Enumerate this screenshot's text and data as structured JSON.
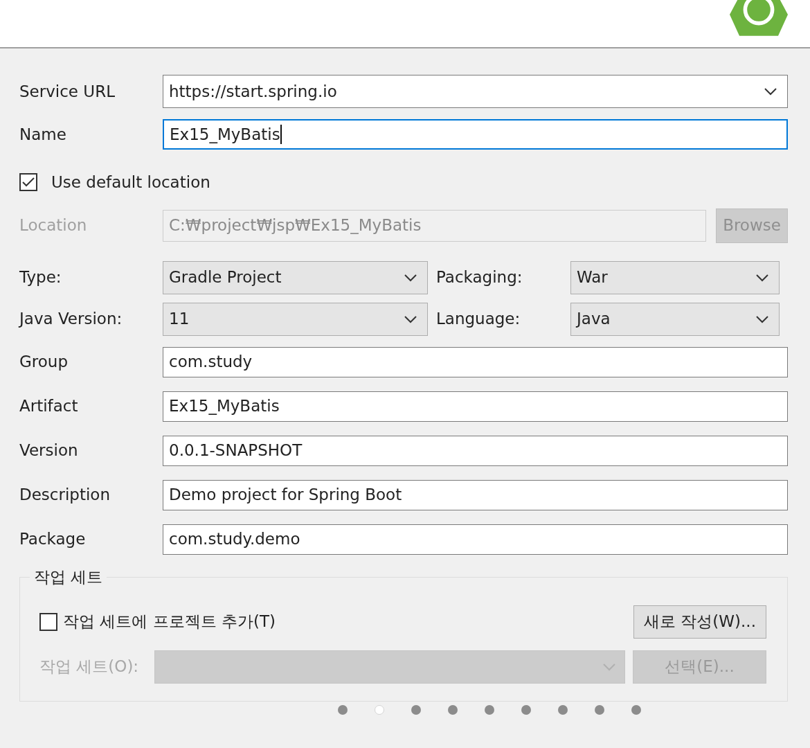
{
  "fields": [
    {
      "label": "Service URL",
      "kind": "combo",
      "value": "https://start.spring.io",
      "focused": false
    },
    {
      "label": "Name",
      "kind": "text",
      "value": "Ex15_MyBatis",
      "focused": true
    }
  ],
  "use_default_location": {
    "label": "Use default location",
    "checked": true
  },
  "location": {
    "label": "Location",
    "value": "C:₩project₩jsp₩Ex15_MyBatis",
    "disabled": true,
    "button": "Browse"
  },
  "options": [
    {
      "label": "Type:",
      "value": "Gradle Project"
    },
    {
      "label": "Packaging:",
      "value": "War"
    },
    {
      "label": "Java Version:",
      "value": "11"
    },
    {
      "label": "Language:",
      "value": "Java"
    }
  ],
  "details": [
    {
      "label": "Group",
      "value": "com.study"
    },
    {
      "label": "Artifact",
      "value": "Ex15_MyBatis"
    },
    {
      "label": "Version",
      "value": "0.0.1-SNAPSHOT"
    },
    {
      "label": "Description",
      "value": "Demo project for Spring Boot"
    },
    {
      "label": "Package",
      "value": "com.study.demo"
    }
  ],
  "working_sets": {
    "title": "작업 세트",
    "add": {
      "label": "작업 세트에 프로젝트 추가(T)",
      "checked": false
    },
    "new_button": "새로 작성(W)...",
    "set_label": "작업 세트(O):",
    "set_disabled": true,
    "select_button": "선택(E)..."
  },
  "busy_dots": [
    {
      "lit": false
    },
    {
      "lit": true
    },
    {
      "lit": false
    },
    {
      "lit": false
    },
    {
      "lit": false
    },
    {
      "lit": false
    },
    {
      "lit": false
    },
    {
      "lit": false
    },
    {
      "lit": false
    }
  ]
}
